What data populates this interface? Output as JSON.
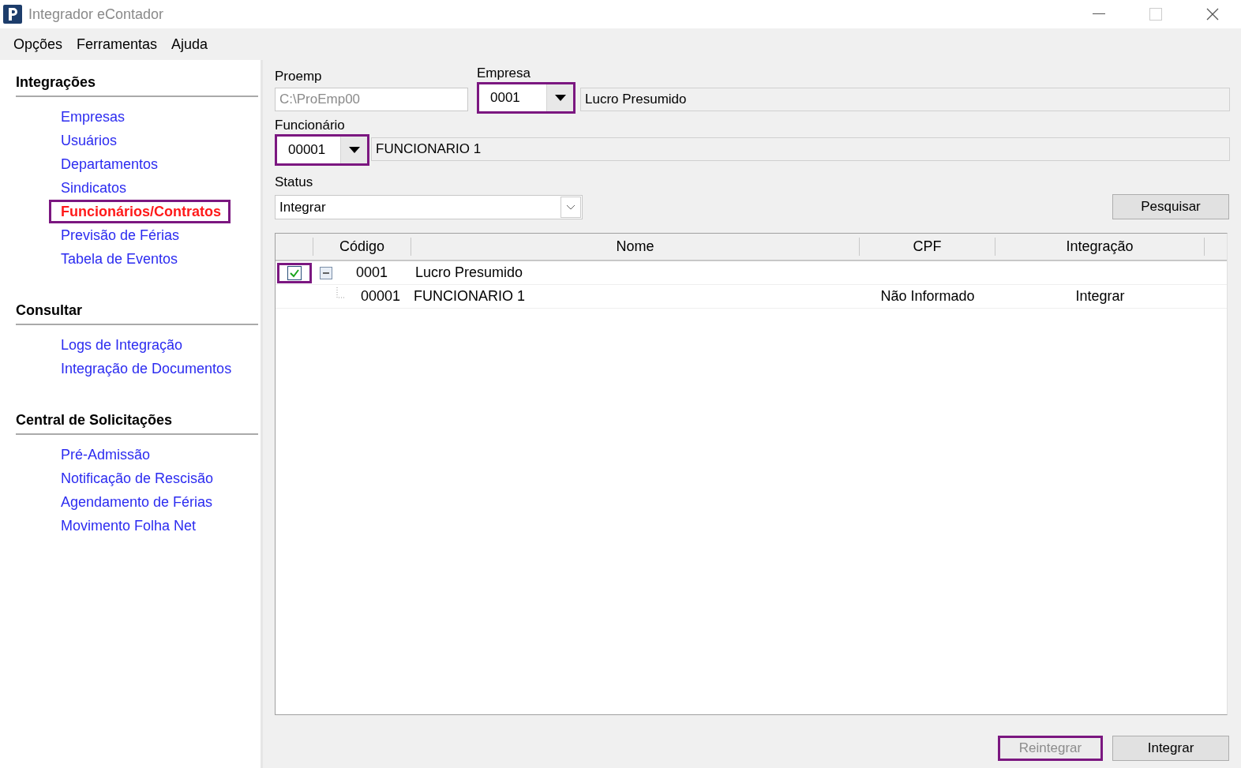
{
  "window": {
    "title": "Integrador eContador"
  },
  "menu": [
    "Opções",
    "Ferramentas",
    "Ajuda"
  ],
  "sidebar": {
    "sections": [
      {
        "title": "Integrações",
        "items": [
          {
            "label": "Empresas",
            "selected": false,
            "highlighted": false
          },
          {
            "label": "Usuários",
            "selected": false,
            "highlighted": false
          },
          {
            "label": "Departamentos",
            "selected": false,
            "highlighted": false
          },
          {
            "label": "Sindicatos",
            "selected": false,
            "highlighted": false
          },
          {
            "label": "Funcionários/Contratos",
            "selected": true,
            "highlighted": true
          },
          {
            "label": "Previsão de Férias",
            "selected": false,
            "highlighted": false
          },
          {
            "label": "Tabela de Eventos",
            "selected": false,
            "highlighted": false
          }
        ]
      },
      {
        "title": "Consultar",
        "items": [
          {
            "label": "Logs de Integração",
            "selected": false,
            "highlighted": false
          },
          {
            "label": "Integração de Documentos",
            "selected": false,
            "highlighted": false
          }
        ]
      },
      {
        "title": "Central de Solicitações",
        "items": [
          {
            "label": "Pré-Admissão",
            "selected": false,
            "highlighted": false
          },
          {
            "label": "Notificação de Rescisão",
            "selected": false,
            "highlighted": false
          },
          {
            "label": "Agendamento de Férias",
            "selected": false,
            "highlighted": false
          },
          {
            "label": "Movimento Folha Net",
            "selected": false,
            "highlighted": false
          }
        ]
      }
    ]
  },
  "form": {
    "proemp": {
      "label": "Proemp",
      "value": "C:\\ProEmp00",
      "disabled": true
    },
    "empresa": {
      "label": "Empresa",
      "code": "0001",
      "name": "Lucro Presumido",
      "highlighted": true
    },
    "funcionario": {
      "label": "Funcionário",
      "code": "00001",
      "name": "FUNCIONARIO 1",
      "highlighted": true
    },
    "status": {
      "label": "Status",
      "value": "Integrar"
    },
    "search_button": "Pesquisar"
  },
  "table": {
    "columns": [
      "Código",
      "Nome",
      "CPF",
      "Integração"
    ],
    "rows": [
      {
        "checked": true,
        "highlighted": true,
        "expanded": true,
        "code": "0001",
        "name": "Lucro Presumido",
        "children": [
          {
            "code": "00001",
            "name": "FUNCIONARIO 1",
            "cpf": "Não Informado",
            "integracao": "Integrar"
          }
        ]
      }
    ]
  },
  "buttons": [
    {
      "label": "Reintegrar",
      "disabled": true,
      "highlighted": true
    },
    {
      "label": "Integrar",
      "disabled": false,
      "highlighted": false
    }
  ]
}
